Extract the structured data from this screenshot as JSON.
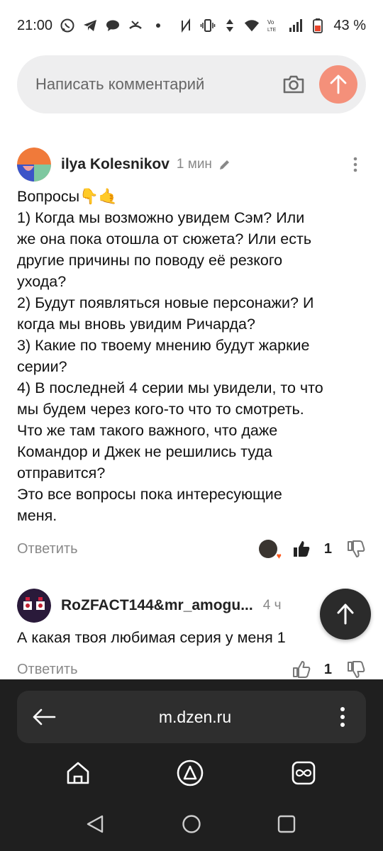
{
  "status_bar": {
    "time": "21:00",
    "battery_percent": "43 %",
    "icons_left": [
      "whatsapp-icon",
      "telegram-icon",
      "chat-icon",
      "missed-call-icon",
      "dot-icon"
    ],
    "icons_right": [
      "nfc-icon",
      "vibrate-icon",
      "data-arrows-icon",
      "wifi-icon",
      "volte-icon",
      "signal-icon",
      "battery-icon"
    ],
    "battery_color": "#e8452c"
  },
  "comment_input": {
    "placeholder": "Написать комментарий",
    "send_color": "#f4907a"
  },
  "comments": [
    {
      "author": "ilya Kolesnikov",
      "time": "1 мин",
      "lines": [
        "Вопросы👇🤙",
        "1) Когда мы возможно увидем Сэм? Или",
        "же она пока отошла от сюжета? Или есть",
        "другие причины по поводу её резкого",
        "ухода?",
        "2) Будут появляться новые персонажи? И",
        "когда мы вновь увидим Ричарда?",
        "3) Какие по твоему мнению будут жаркие",
        "серии?",
        "4) В последней 4 серии мы увидели, то что",
        "мы будем через кого-то что то смотреть.",
        "Что же там такого важного, что даже",
        "Командор и Джек не решились туда",
        "отправится?",
        "Это все вопросы пока интересующие",
        "меня."
      ],
      "reply_label": "Ответить",
      "likes": "1",
      "liked": true
    },
    {
      "author": "RoZFACT144&mr_amogu...",
      "time": "4 ч",
      "lines": [
        "А какая твоя любимая серия у меня 1"
      ],
      "reply_label": "Ответить",
      "likes": "1",
      "liked": false
    }
  ],
  "browser": {
    "url": "m.dzen.ru"
  }
}
